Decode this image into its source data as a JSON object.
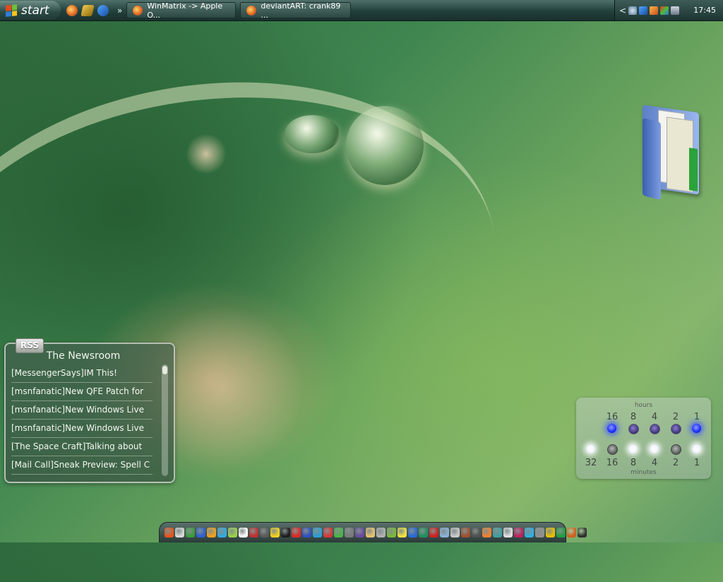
{
  "taskbar": {
    "start_label": "start",
    "tasks": [
      {
        "label": "WinMatrix -> Apple O..."
      },
      {
        "label": "deviantART: crank89 ..."
      }
    ],
    "overflow_label": "»",
    "tray_expand_label": "<",
    "clock": "17:45"
  },
  "rss_gadget": {
    "badge": "RSS",
    "title": "The Newsroom",
    "items": [
      {
        "text": "[MessengerSays]IM This!"
      },
      {
        "text": "[msnfanatic]New QFE Patch for"
      },
      {
        "text": "[msnfanatic]New Windows Live"
      },
      {
        "text": "[msnfanatic]New Windows Live"
      },
      {
        "text": "[The Space Craft]Talking about"
      },
      {
        "text": "[Mail Call]Sneak Preview: Spell C"
      }
    ]
  },
  "binary_clock": {
    "hours_label": "hours",
    "minutes_label": "minutes",
    "hour_bits": [
      "16",
      "8",
      "4",
      "2",
      "1"
    ],
    "minute_bits": [
      "32",
      "16",
      "8",
      "4",
      "2",
      "1"
    ],
    "hour_states": [
      1,
      0,
      0,
      0,
      1
    ],
    "minute_states": [
      1,
      0,
      1,
      1,
      0,
      1
    ]
  },
  "colors": {
    "taskbar": "#22403b",
    "led_blue": "#1a2cff",
    "led_white": "#ffffff"
  },
  "icons": {
    "quick_launch": [
      "firefox-icon",
      "app-icon",
      "messenger-icon"
    ],
    "tray": [
      "network-icon",
      "messenger-icon",
      "app-icon",
      "shield-icon",
      "display-icon"
    ],
    "desktop": [
      "documents-folder-icon"
    ],
    "dock_count": 40
  }
}
